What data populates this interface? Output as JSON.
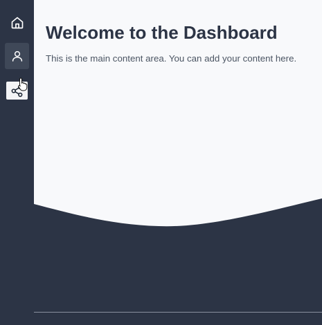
{
  "sidebar": {
    "items": [
      {
        "name": "home",
        "icon": "home-icon"
      },
      {
        "name": "user",
        "icon": "user-icon",
        "active": true
      },
      {
        "name": "share",
        "icon": "share-icon",
        "hovered": true
      }
    ]
  },
  "main": {
    "title": "Welcome to the Dashboard",
    "text": "This is the main content area. You can add your content here."
  },
  "colors": {
    "sidebar_bg": "#2c3445",
    "content_bg": "#f8f9fb",
    "title_color": "#2c3445",
    "text_color": "#4b5563",
    "active_item_bg": "#3f4858",
    "hover_item_bg": "#f3f4f6"
  }
}
